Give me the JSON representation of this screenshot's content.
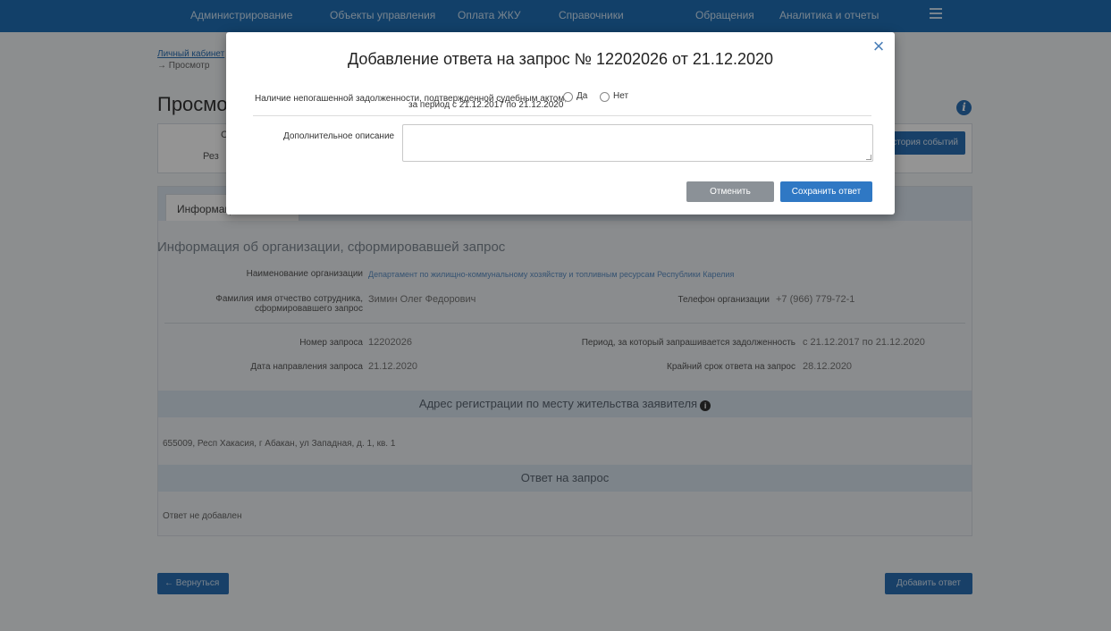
{
  "nav": {
    "items": [
      "Администрирование",
      "Объекты управления",
      "Оплата ЖКУ",
      "Справочники",
      "Обращения",
      "Аналитика и отчеты"
    ]
  },
  "breadcrumb": {
    "link": "Личный кабинет",
    "current": "→ Просмотр"
  },
  "page": {
    "title": "Просмотр",
    "summary_fragment_1": "С",
    "summary_fragment_2": "Рез",
    "history_button": "История событий",
    "tab_label": "Информация"
  },
  "org_section": {
    "title": "Информация об организации, сформировавшей запрос",
    "org_name_label": "Наименование организации",
    "org_name_value": "Департамент по жилищно-коммунальному хозяйству и топливным ресурсам Республики Карелия",
    "employee_label_1": "Фамилия имя отчество сотрудника,",
    "employee_label_2": "сформировавшего запрос",
    "employee_value": "Зимин Олег Федорович",
    "phone_label": "Телефон организации",
    "phone_value": "+7 (966) 779-72-1",
    "request_no_label": "Номер запроса",
    "request_no_value": "12202026",
    "period_label": "Период, за который запрашивается задолженность",
    "period_value": "с 21.12.2017 по 21.12.2020",
    "sent_date_label": "Дата направления запроса",
    "sent_date_value": "21.12.2020",
    "deadline_label": "Крайний срок ответа на запрос",
    "deadline_value": "28.12.2020"
  },
  "address_section": {
    "title": "Адрес регистрации по месту жительства заявителя",
    "value": "655009, Респ Хакасия, г Абакан, ул Западная, д. 1, кв. 1"
  },
  "answer_section": {
    "title": "Ответ на запрос",
    "value": "Ответ не добавлен"
  },
  "bottom": {
    "back_button": "← Вернуться",
    "add_button": "Добавить ответ"
  },
  "modal": {
    "title": "Добавление ответа на запрос № 12202026 от 21.12.2020",
    "question_line1": "Наличие непогашенной задолженности, подтвержденной судебным актом,",
    "question_line2": "за период с 21.12.2017 по 21.12.2020",
    "required_mark": "*",
    "option_yes": "Да",
    "option_no": "Нет",
    "description_label": "Дополнительное описание",
    "description_value": "",
    "cancel_button": "Отменить",
    "save_button": "Сохранить ответ",
    "close_glyph": "×"
  },
  "colors": {
    "nav_bg": "#1f6fb5",
    "primary": "#2f78c4",
    "cancel": "#8b9197"
  }
}
